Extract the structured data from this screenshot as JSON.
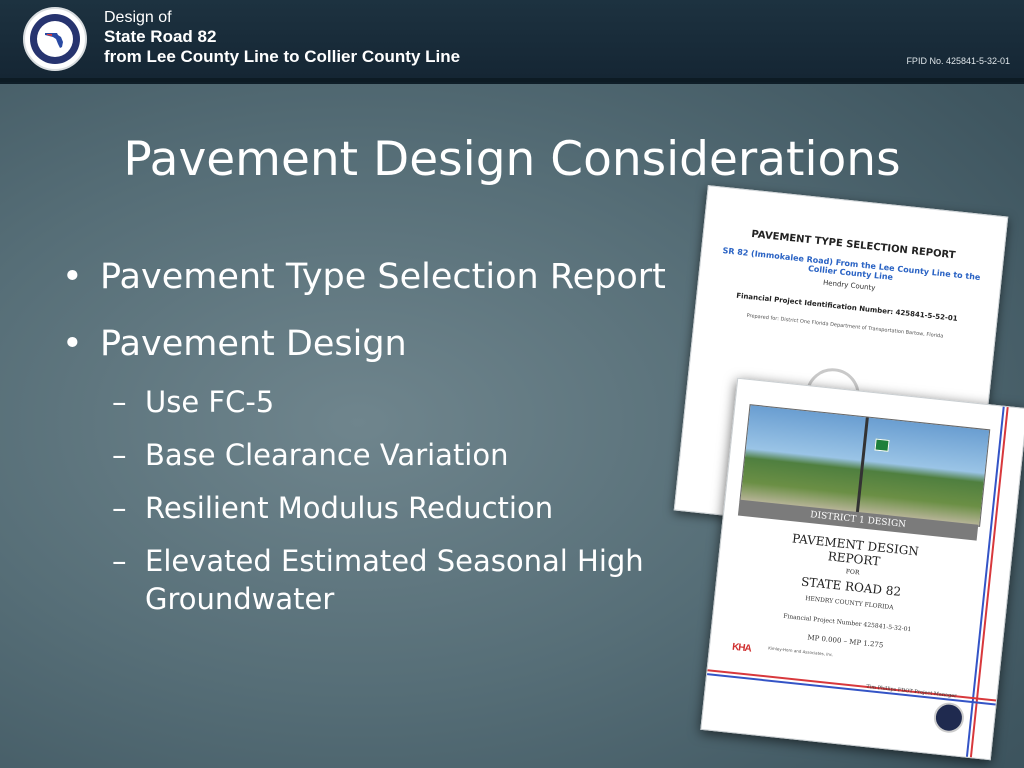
{
  "header": {
    "line1": "Design of",
    "line2": "State Road 82",
    "line3": "from Lee County Line to Collier County Line",
    "fpid": "FPID No. 425841-5-32-01",
    "seal_icon": "fdot-seal-icon"
  },
  "title": "Pavement Design Considerations",
  "bullets": [
    "Pavement Type Selection Report",
    "Pavement Design"
  ],
  "sub_bullets": [
    "Use FC-5",
    "Base Clearance Variation",
    "Resilient Modulus Reduction",
    "Elevated Estimated Seasonal High Groundwater"
  ],
  "sub_dash": "–",
  "doc_type_selection": {
    "heading": "PAVEMENT TYPE SELECTION REPORT",
    "subtitle": "SR 82 (Immokalee Road) From the Lee County Line to the Collier County Line",
    "county": "Hendry County",
    "financial": "Financial Project Identification Number: 425841-5-52-01",
    "prepared": "Prepared for: District One Florida Department of Transportation Bartow, Florida"
  },
  "doc_pavement_design": {
    "band": "DISTRICT 1 DESIGN",
    "title_line1": "PAVEMENT DESIGN",
    "title_line2": "REPORT",
    "for": "FOR",
    "title_line3": "STATE ROAD 82",
    "county": "HENDRY COUNTY FLORIDA",
    "financial": "Financial Project Number 425841-5-32-01",
    "mp": "MP 0.000 – MP 1.275",
    "firm_logo": "KHA",
    "firm_name": "Kimley-Horn and Associates, Inc.",
    "manager": "Tim Phillips FDOT Project Manager"
  },
  "colors": {
    "header_bg": "#1a2d3b",
    "slide_bg": "#566e77",
    "text": "#ffffff",
    "accent_blue": "#3454c6",
    "accent_red": "#d8383c"
  }
}
